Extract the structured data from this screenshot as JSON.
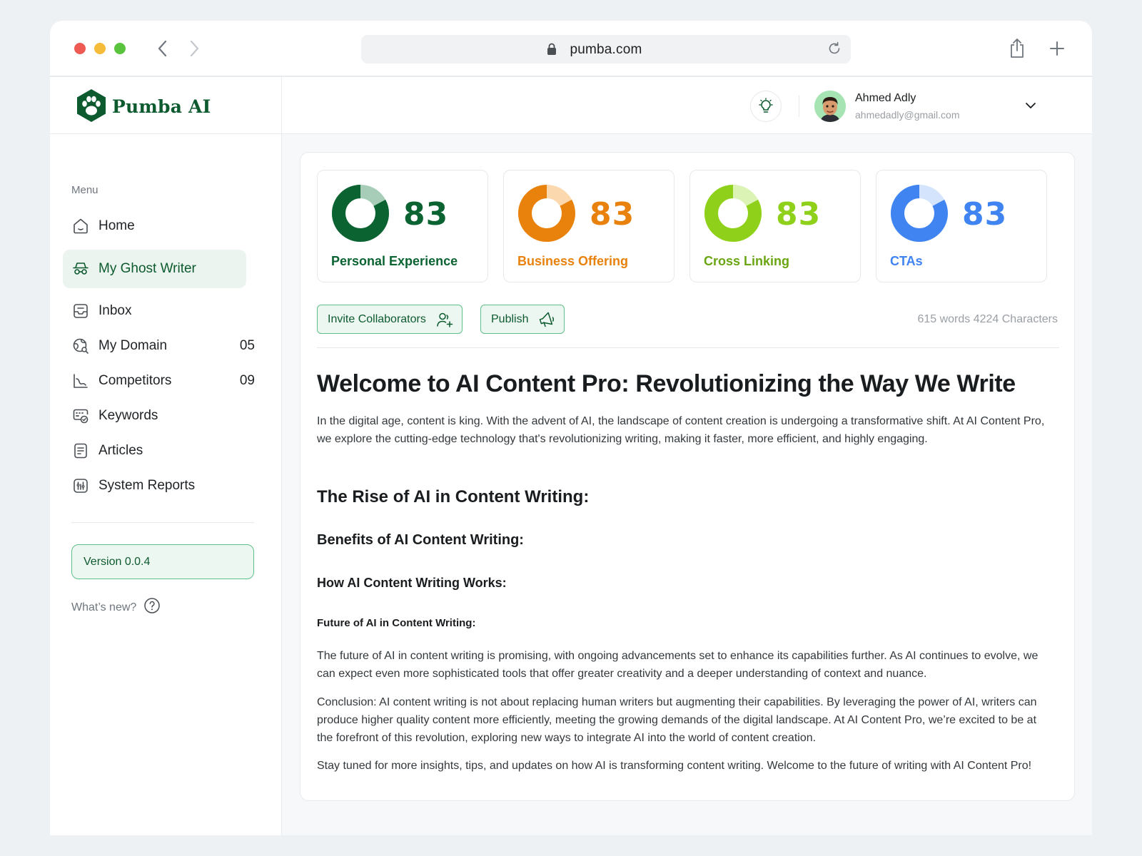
{
  "browser": {
    "url": "pumba.com"
  },
  "brand": {
    "name": "Pumba AI",
    "color": "#0d5a2f"
  },
  "sidebar": {
    "menu_title": "Menu",
    "items": [
      {
        "label": "Home",
        "icon": "home-icon",
        "count": ""
      },
      {
        "label": "My Ghost Writer",
        "icon": "ghost-writer-icon",
        "count": "",
        "active": true
      },
      {
        "label": "Inbox",
        "icon": "inbox-icon",
        "count": ""
      },
      {
        "label": "My Domain",
        "icon": "globe-icon",
        "count": "05"
      },
      {
        "label": "Competitors",
        "icon": "chart-icon",
        "count": "09"
      },
      {
        "label": "Keywords",
        "icon": "keyword-icon",
        "count": ""
      },
      {
        "label": "Articles",
        "icon": "document-icon",
        "count": ""
      },
      {
        "label": "System Reports",
        "icon": "report-icon",
        "count": ""
      }
    ],
    "version": "Version 0.0.4",
    "whats_new": "What’s new?"
  },
  "user": {
    "name": "Ahmed Adly",
    "email": "ahmedadly@gmail.com"
  },
  "scores": [
    {
      "value": "83",
      "label": "Personal Experience",
      "color": "#0b6332",
      "light": "#a7cdb8",
      "fraction": 0.83
    },
    {
      "value": "83",
      "label": "Business Offering",
      "color": "#e8820c",
      "light": "#fbd8ae",
      "fraction": 0.83
    },
    {
      "value": "83",
      "label": "Cross Linking",
      "color": "#8fd11a",
      "light": "#dcf3b6",
      "fraction": 0.83
    },
    {
      "value": "83",
      "label": "CTAs",
      "color": "#3f84f0",
      "light": "#d4e4fc",
      "fraction": 0.83
    }
  ],
  "label_colors": [
    "#0b6332",
    "#e8820c",
    "#6aa512",
    "#3f84f0"
  ],
  "actions": {
    "invite": "Invite Collaborators",
    "publish": "Publish",
    "counts": "615 words 4224 Characters"
  },
  "article": {
    "title": "Welcome to AI Content Pro: Revolutionizing the Way We Write",
    "intro": "In the digital age, content is king. With the advent of AI, the landscape of content creation is undergoing a transformative shift. At AI Content Pro, we explore the cutting-edge technology that's revolutionizing writing, making it faster, more efficient, and highly engaging.",
    "h_rise": "The Rise of AI in Content Writing:",
    "h_benefits": "Benefits of AI Content Writing:",
    "h_how": "How AI Content Writing Works:",
    "h_future": "Future of AI in Content Writing:",
    "p_future": "The future of AI in content writing is promising, with ongoing advancements set to enhance its capabilities further. As AI continues to evolve, we can expect even more sophisticated tools that offer greater creativity and a deeper understanding of context and nuance.",
    "p_conclusion": "Conclusion: AI content writing is not about replacing human writers but augmenting their capabilities. By leveraging the power of AI, writers can produce higher quality content more efficiently, meeting the growing demands of the digital landscape. At AI Content Pro, we’re excited to be at the forefront of this revolution, exploring new ways to integrate AI into the world of content creation.",
    "p_stay": "Stay tuned for more insights, tips, and updates on how AI is transforming content writing. Welcome to the future of writing with AI Content Pro!"
  }
}
